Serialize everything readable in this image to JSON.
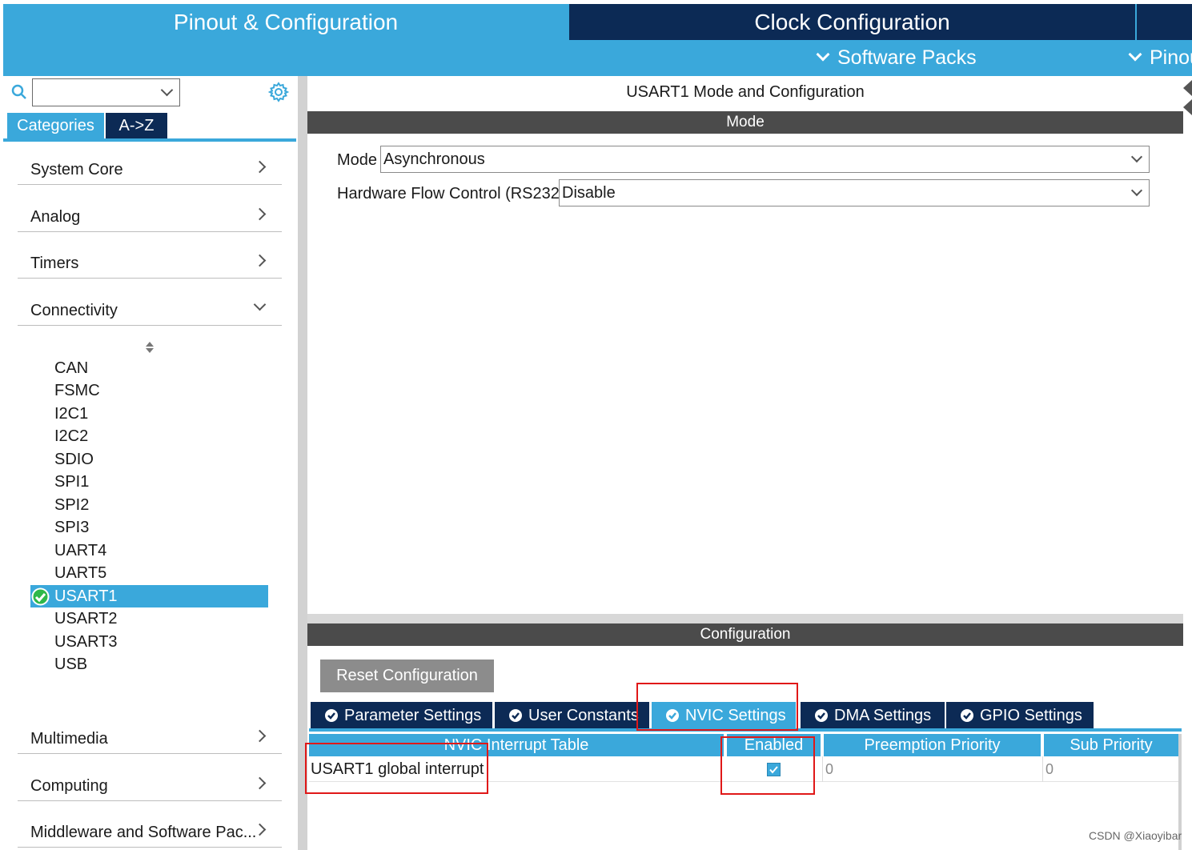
{
  "header": {
    "tab_pinout": "Pinout & Configuration",
    "tab_clock": "Clock Configuration",
    "software_packs": "Software Packs",
    "pinout_menu": "Pinou"
  },
  "sidebar": {
    "search_placeholder": "",
    "tabs": [
      "Categories",
      "A->Z"
    ],
    "categories_top": [
      "System Core",
      "Analog",
      "Timers",
      "Connectivity"
    ],
    "connectivity_items": [
      "CAN",
      "FSMC",
      "I2C1",
      "I2C2",
      "SDIO",
      "SPI1",
      "SPI2",
      "SPI3",
      "UART4",
      "UART5",
      "USART1",
      "USART2",
      "USART3",
      "USB"
    ],
    "selected_item": "USART1",
    "categories_bottom": [
      "Multimedia",
      "Computing",
      "Middleware and Software Pac..."
    ]
  },
  "mode_panel": {
    "title": "USART1 Mode and Configuration",
    "section": "Mode",
    "mode_label": "Mode",
    "mode_value": "Asynchronous",
    "flow_label": "Hardware Flow Control (RS232)",
    "flow_value": "Disable"
  },
  "config_panel": {
    "section": "Configuration",
    "reset_button": "Reset Configuration",
    "tabs": [
      "Parameter Settings",
      "User Constants",
      "NVIC Settings",
      "DMA Settings",
      "GPIO Settings"
    ],
    "active_tab": "NVIC Settings",
    "table": {
      "columns": [
        "NVIC Interrupt Table",
        "Enabled",
        "Preemption Priority",
        "Sub Priority"
      ],
      "rows": [
        {
          "name": "USART1 global interrupt",
          "enabled": true,
          "preemption": "0",
          "sub": "0"
        }
      ]
    }
  },
  "colors": {
    "accent": "#3aa8db",
    "navy": "#0c2a55",
    "section_header": "#4b4b4b",
    "highlight": "#e01818"
  },
  "watermark": "CSDN @Xiaoyibar"
}
